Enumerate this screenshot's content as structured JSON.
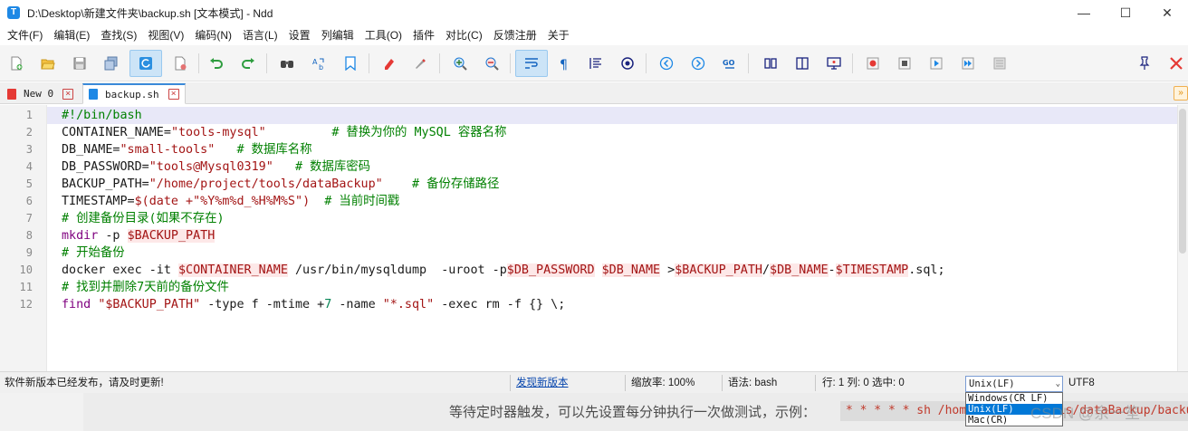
{
  "window": {
    "title": "D:\\Desktop\\新建文件夹\\backup.sh [文本模式] - Ndd",
    "app_icon_letter": "T",
    "minimize_glyph": "—",
    "maximize_glyph": "☐",
    "close_glyph": "✕"
  },
  "menu": [
    "文件(F)",
    "编辑(E)",
    "查找(S)",
    "视图(V)",
    "编码(N)",
    "语言(L)",
    "设置",
    "列编辑",
    "工具(O)",
    "插件",
    "对比(C)",
    "反馈注册",
    "关于"
  ],
  "toolbar_icons": [
    "new-file-icon",
    "open-file-icon",
    "save-icon",
    "save-all-icon",
    "reload-icon",
    "close-file-icon",
    "undo-icon",
    "redo-icon",
    "find-icon",
    "replace-icon",
    "bookmark-icon",
    "mark-icon",
    "clear-mark-icon",
    "zoom-in-icon",
    "zoom-out-icon",
    "word-wrap-icon",
    "show-symbols-icon",
    "indent-guide-icon",
    "target-icon",
    "prev-icon",
    "next-icon",
    "goto-icon",
    "compare-icon",
    "split-icon",
    "screen-icon",
    "record-icon",
    "stop-icon",
    "play-icon",
    "play-multi-icon",
    "save-macro-icon",
    "pin-icon",
    "close-red-icon"
  ],
  "tabs": [
    {
      "label": "New 0",
      "active": false
    },
    {
      "label": "backup.sh",
      "active": true
    }
  ],
  "tab_scroll_glyph": "»",
  "editor": {
    "line_numbers": [
      "1",
      "2",
      "3",
      "4",
      "5",
      "6",
      "7",
      "8",
      "9",
      "10",
      "11",
      "12"
    ],
    "lines": [
      [
        {
          "t": "#!/bin/bash",
          "c": "comment"
        }
      ],
      [
        {
          "t": "CONTAINER_NAME=",
          "c": "op"
        },
        {
          "t": "\"tools-mysql\"",
          "c": "string"
        },
        {
          "t": "         ",
          "c": "op"
        },
        {
          "t": "# 替换为你的 MySQL 容器名称",
          "c": "comment"
        }
      ],
      [
        {
          "t": "DB_NAME=",
          "c": "op"
        },
        {
          "t": "\"small-tools\"",
          "c": "string"
        },
        {
          "t": "   ",
          "c": "op"
        },
        {
          "t": "# 数据库名称",
          "c": "comment"
        }
      ],
      [
        {
          "t": "DB_PASSWORD=",
          "c": "op"
        },
        {
          "t": "\"tools@Mysql0319\"",
          "c": "string"
        },
        {
          "t": "   ",
          "c": "op"
        },
        {
          "t": "# 数据库密码",
          "c": "comment"
        }
      ],
      [
        {
          "t": "BACKUP_PATH=",
          "c": "op"
        },
        {
          "t": "\"/home/project/tools/dataBackup\"",
          "c": "string"
        },
        {
          "t": "    ",
          "c": "op"
        },
        {
          "t": "# 备份存储路径",
          "c": "comment"
        }
      ],
      [
        {
          "t": "TIMESTAMP=",
          "c": "op"
        },
        {
          "t": "$(",
          "c": "string"
        },
        {
          "t": "date +",
          "c": "string"
        },
        {
          "t": "\"%Y%m%d_%H%M%S\"",
          "c": "string"
        },
        {
          "t": ")",
          "c": "string"
        },
        {
          "t": "  ",
          "c": "op"
        },
        {
          "t": "# 当前时间戳",
          "c": "comment"
        }
      ],
      [
        {
          "t": "# 创建备份目录(如果不存在)",
          "c": "comment"
        }
      ],
      [
        {
          "t": "mkdir",
          "c": "kw"
        },
        {
          "t": " -p ",
          "c": "op"
        },
        {
          "t": "$BACKUP_PATH",
          "c": "var"
        }
      ],
      [
        {
          "t": "# 开始备份",
          "c": "comment"
        }
      ],
      [
        {
          "t": "docker exec -it ",
          "c": "op"
        },
        {
          "t": "$CONTAINER_NAME",
          "c": "var"
        },
        {
          "t": " /usr/bin/mysqldump  -uroot -p",
          "c": "op"
        },
        {
          "t": "$DB_PASSWORD",
          "c": "var"
        },
        {
          "t": " ",
          "c": "op"
        },
        {
          "t": "$DB_NAME",
          "c": "var"
        },
        {
          "t": " >",
          "c": "op"
        },
        {
          "t": "$BACKUP_PATH",
          "c": "var"
        },
        {
          "t": "/",
          "c": "op"
        },
        {
          "t": "$DB_NAME",
          "c": "var"
        },
        {
          "t": "-",
          "c": "op"
        },
        {
          "t": "$TIMESTAMP",
          "c": "var"
        },
        {
          "t": ".sql;",
          "c": "op"
        }
      ],
      [
        {
          "t": "# 找到并删除7天前的备份文件",
          "c": "comment"
        }
      ],
      [
        {
          "t": "find",
          "c": "kw"
        },
        {
          "t": " ",
          "c": "op"
        },
        {
          "t": "\"$BACKUP_PATH\"",
          "c": "string"
        },
        {
          "t": " -type f -mtime +",
          "c": "op"
        },
        {
          "t": "7",
          "c": "num"
        },
        {
          "t": " -name ",
          "c": "op"
        },
        {
          "t": "\"*.sql\"",
          "c": "string"
        },
        {
          "t": " -exec rm -f {} \\;",
          "c": "op"
        }
      ]
    ]
  },
  "status": {
    "message": "软件新版本已经发布，请及时更新!",
    "update_link": "发现新版本",
    "zoom": "缩放率: 100%",
    "syntax": "语法: bash",
    "position": "行: 1 列: 0 选中: 0",
    "eol_selected": "Unix(LF)",
    "eol_arrow": "⌄",
    "encoding": "UTF8"
  },
  "eol_options": [
    "Windows(CR LF)",
    "Unix(LF)",
    "Mac(CR)"
  ],
  "background_page": {
    "text": "等待定时器触发，可以先设置每分钟执行一次做测试，示例：",
    "code": "* * * * * sh /home/project/tools/dataBackup/backup.sh",
    "watermark": "CSDN @余一笙"
  },
  "colors": {
    "accent_blue": "#3b8ad9",
    "comment": "#008000",
    "string": "#a31515",
    "keyword": "#7f007f",
    "number": "#098658",
    "current_line": "#e8e8f8",
    "selection": "#0078d7"
  }
}
